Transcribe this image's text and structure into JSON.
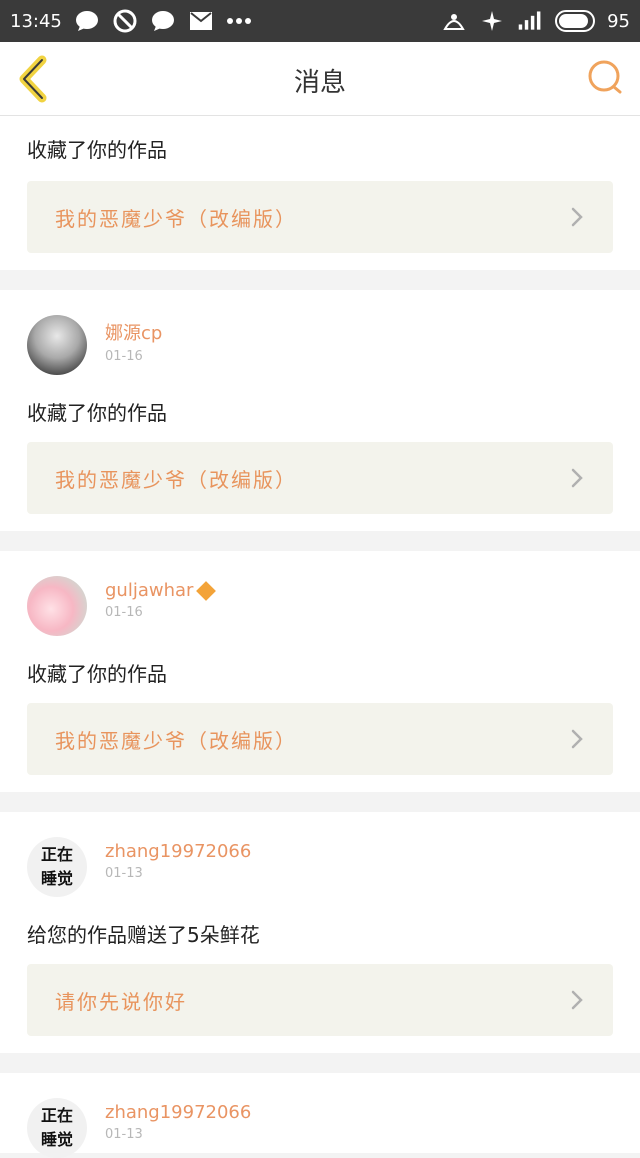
{
  "status_bar": {
    "time": "13:45",
    "left_icons": [
      "chat-bubble-icon",
      "blocked-icon",
      "chat-bubble-icon",
      "mail-icon",
      "more-dots-icon"
    ],
    "right_icons": [
      "hat-icon",
      "sparkle-icon",
      "signal-icon"
    ],
    "battery_level": "95"
  },
  "header": {
    "title": "消息"
  },
  "accent_color": "#e99463",
  "feed": [
    {
      "action": "收藏了你的作品",
      "work_title": "我的恶魔少爷（改编版）"
    },
    {
      "username": "娜源cp",
      "date": "01-16",
      "action": "收藏了你的作品",
      "work_title": "我的恶魔少爷（改编版）"
    },
    {
      "username": "guljawhar",
      "date": "01-16",
      "action": "收藏了你的作品",
      "work_title": "我的恶魔少爷（改编版）"
    },
    {
      "avatar_text": [
        "正在",
        "睡觉"
      ],
      "username": "zhang19972066",
      "date": "01-13",
      "action": "给您的作品赠送了5朵鲜花",
      "work_title": "请你先说你好"
    },
    {
      "avatar_text": [
        "正在",
        "睡觉"
      ],
      "username": "zhang19972066",
      "date": "01-13"
    }
  ]
}
